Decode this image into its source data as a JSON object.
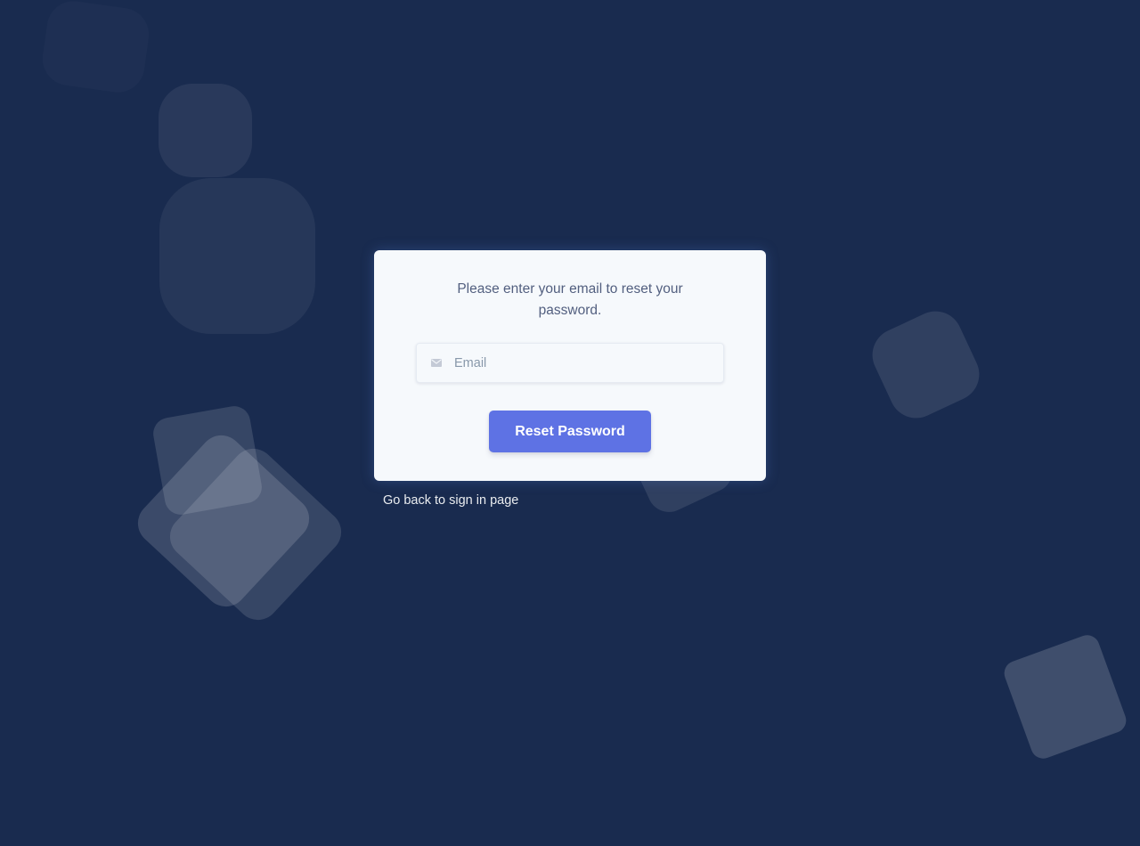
{
  "reset_card": {
    "instructions": "Please enter your email to reset your password.",
    "email_placeholder": "Email",
    "email_value": "",
    "email_icon": "envelope-icon",
    "submit_label": "Reset Password"
  },
  "footer_links": {
    "back_to_sign_in": "Go back to sign in page"
  },
  "colors": {
    "background": "#192b4f",
    "card": "#f6f9fc",
    "primary_button": "#5e72e4",
    "text_muted": "#525f7f"
  }
}
